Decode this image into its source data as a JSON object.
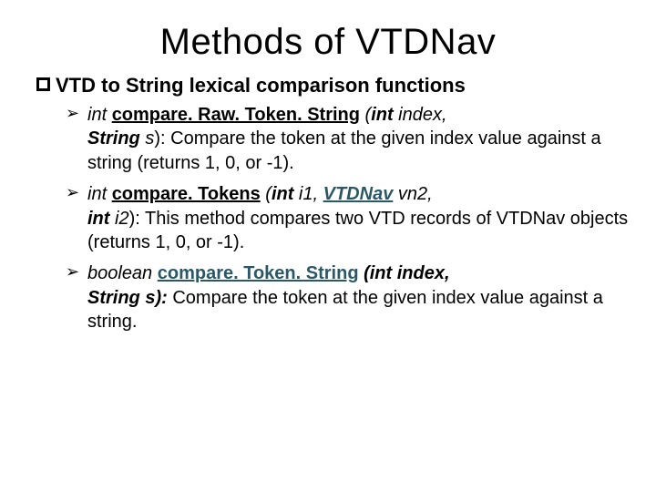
{
  "title": "Methods of VTDNav",
  "section_heading": "VTD to String lexical comparison functions",
  "bullets": [
    {
      "ret": "int",
      "method": "compare. Raw. Token. String",
      "params_open": " (",
      "params_a": "int",
      "params_b": " index,",
      "line2_param_a": "String",
      "line2_param_b": " s",
      "line2_close": "): ",
      "desc": "Compare the token at the given index value against a string (returns 1, 0,    or  -1)."
    },
    {
      "ret": "int",
      "method": "compare. Tokens",
      "params_open": " (",
      "params_a": "int",
      "params_b": " i",
      "params_c": "1, ",
      "params_d": "VTDNav",
      "params_e": " vn",
      "params_f": "2,",
      "line2_param_a": "int",
      "line2_param_b": " i",
      "line2_param_c": "2",
      "line2_close": "): ",
      "desc": "This method compares two VTD records of VTDNav objects (returns 1, 0, or -1)."
    },
    {
      "ret": "boolean",
      "method": "compare. Token. String",
      "params_open": " (int index,",
      "line2_param": "String s):",
      "desc": " Compare the token at the given index value against a string."
    }
  ]
}
